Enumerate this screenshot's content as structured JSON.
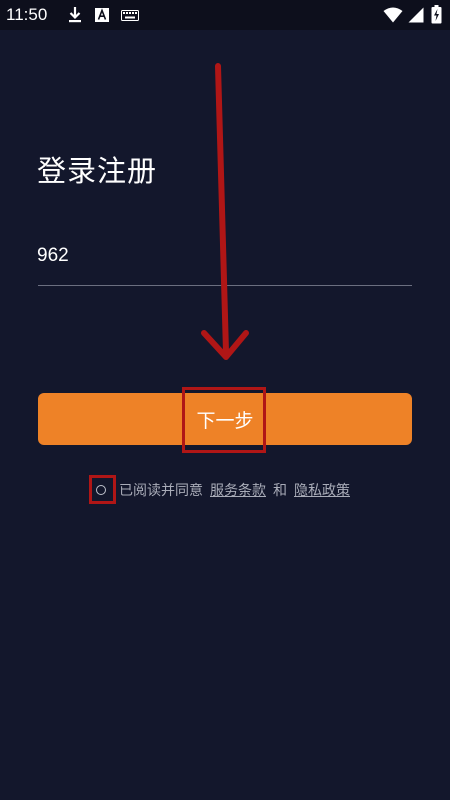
{
  "status_bar": {
    "time": "11:50",
    "icons": [
      "download-icon",
      "a-notification-icon",
      "keyboard-icon",
      "wifi-icon",
      "signal-icon",
      "battery-charging-icon"
    ]
  },
  "page": {
    "title": "登录注册"
  },
  "phone": {
    "value": "962",
    "placeholder": ""
  },
  "next_button": {
    "label": "下一步",
    "color": "#ee8227"
  },
  "agreement": {
    "prefix": "已阅读并同意",
    "terms_link": "服务条款",
    "conjunction": "和",
    "privacy_link": "隐私政策"
  },
  "theme": {
    "background": "#13172c",
    "annotation_color": "#b01616"
  }
}
